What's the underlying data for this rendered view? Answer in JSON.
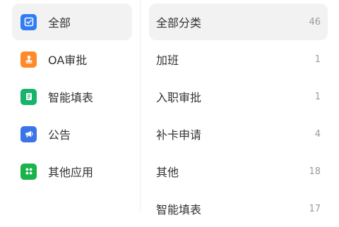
{
  "categories": [
    {
      "label": "全部",
      "icon": "all-apps-icon",
      "color": "#2f7cf6",
      "active": true
    },
    {
      "label": "OA审批",
      "icon": "approval-stamp-icon",
      "color": "#ff8a2a",
      "active": false
    },
    {
      "label": "智能填表",
      "icon": "form-document-icon",
      "color": "#19b36b",
      "active": false
    },
    {
      "label": "公告",
      "icon": "announcement-icon",
      "color": "#3b73e8",
      "active": false
    },
    {
      "label": "其他应用",
      "icon": "grid-apps-icon",
      "color": "#19b34a",
      "active": false
    }
  ],
  "items": [
    {
      "label": "全部分类",
      "count": "46",
      "active": true
    },
    {
      "label": "加班",
      "count": "1",
      "active": false
    },
    {
      "label": "入职审批",
      "count": "1",
      "active": false
    },
    {
      "label": "补卡申请",
      "count": "4",
      "active": false
    },
    {
      "label": "其他",
      "count": "18",
      "active": false
    },
    {
      "label": "智能填表",
      "count": "17",
      "active": false
    }
  ]
}
